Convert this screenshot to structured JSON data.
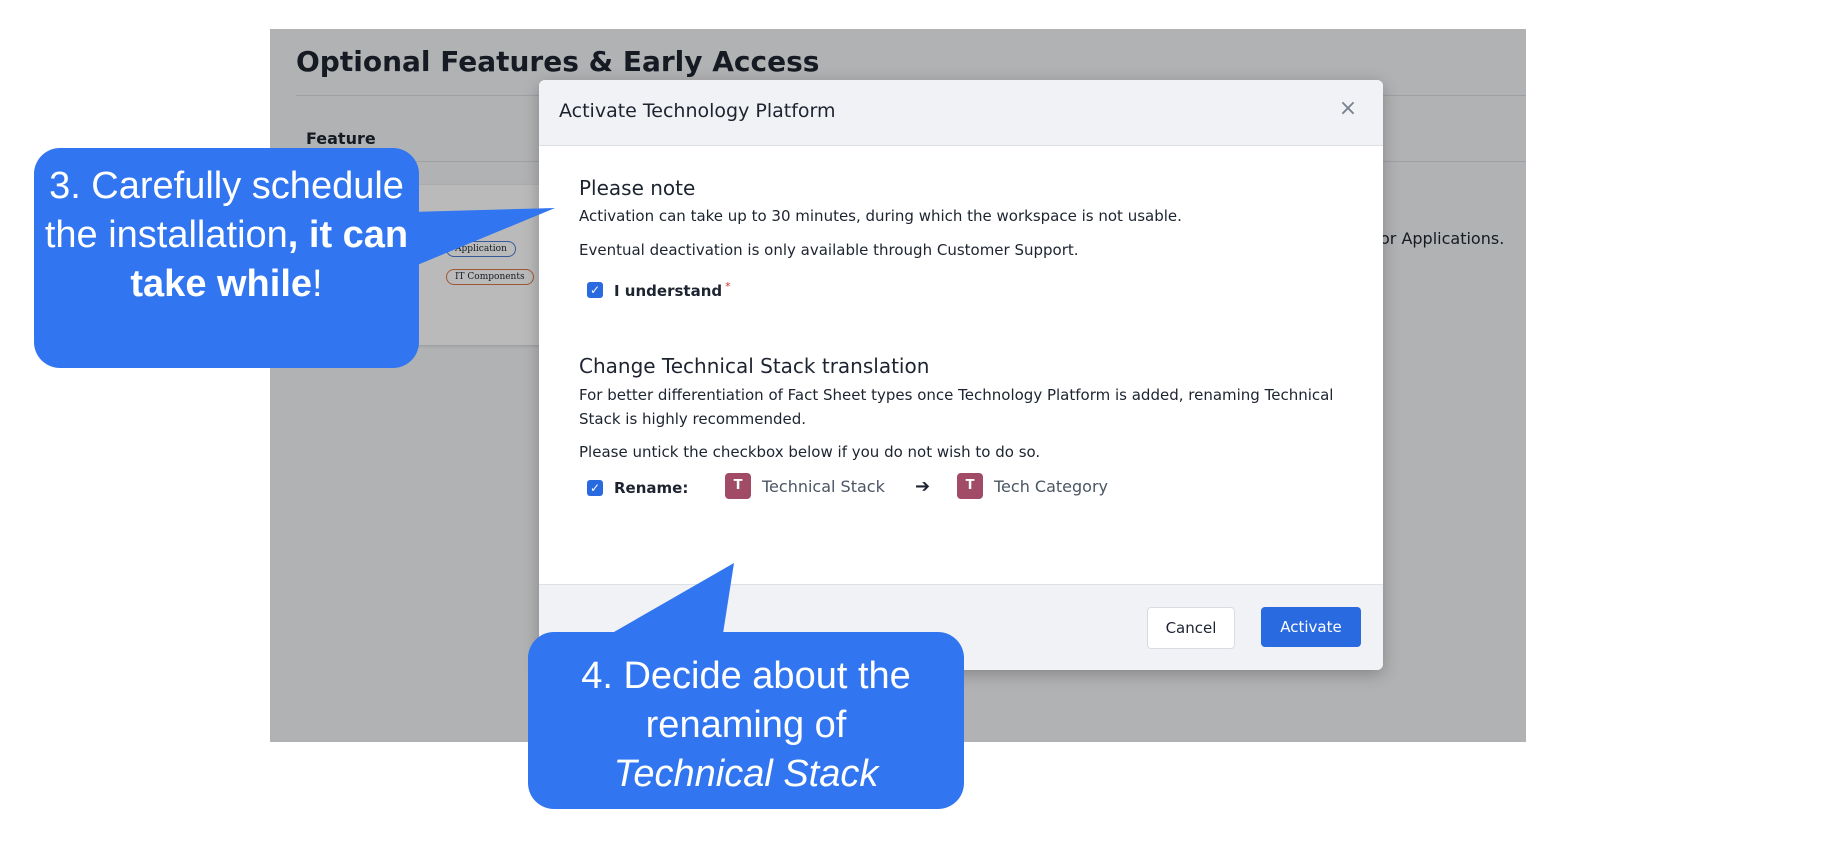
{
  "background": {
    "page_title": "Optional Features & Early Access",
    "column_header": "Feature",
    "diagram_pills": [
      "Application",
      "IT Components"
    ],
    "side_text": "or Applications."
  },
  "modal": {
    "title": "Activate Technology Platform",
    "close_icon": "close-icon",
    "note_title": "Please note",
    "note_line1": "Activation can take up to 30 minutes, during which the workspace is not usable.",
    "note_line2": "Eventual deactivation is only available through Customer Support.",
    "understand_label": "I understand",
    "understand_checked": true,
    "required_mark": "*",
    "rename_section_title": "Change Technical Stack translation",
    "rename_para1": "For better differentiation of Fact Sheet types once Technology Platform is added, renaming Technical Stack is highly recommended.",
    "rename_para2": "Please untick the checkbox below if you do not wish to do so.",
    "rename_label": "Rename:",
    "rename_checked": true,
    "from_badge": "T",
    "from_name": "Technical Stack",
    "arrow_icon": "arrow-right-icon",
    "to_badge": "T",
    "to_name": "Tech Category",
    "cancel_label": "Cancel",
    "activate_label": "Activate"
  },
  "callouts": {
    "c1_part1": "3. Carefully schedule the installation",
    "c1_bold": ", it can take while",
    "c1_end": "!",
    "c2_line": "4. Decide about the renaming of",
    "c2_italic": "Technical Stack"
  },
  "colors": {
    "accent": "#2a6ae0",
    "callout": "#3176f0",
    "badge": "#a14b66"
  }
}
